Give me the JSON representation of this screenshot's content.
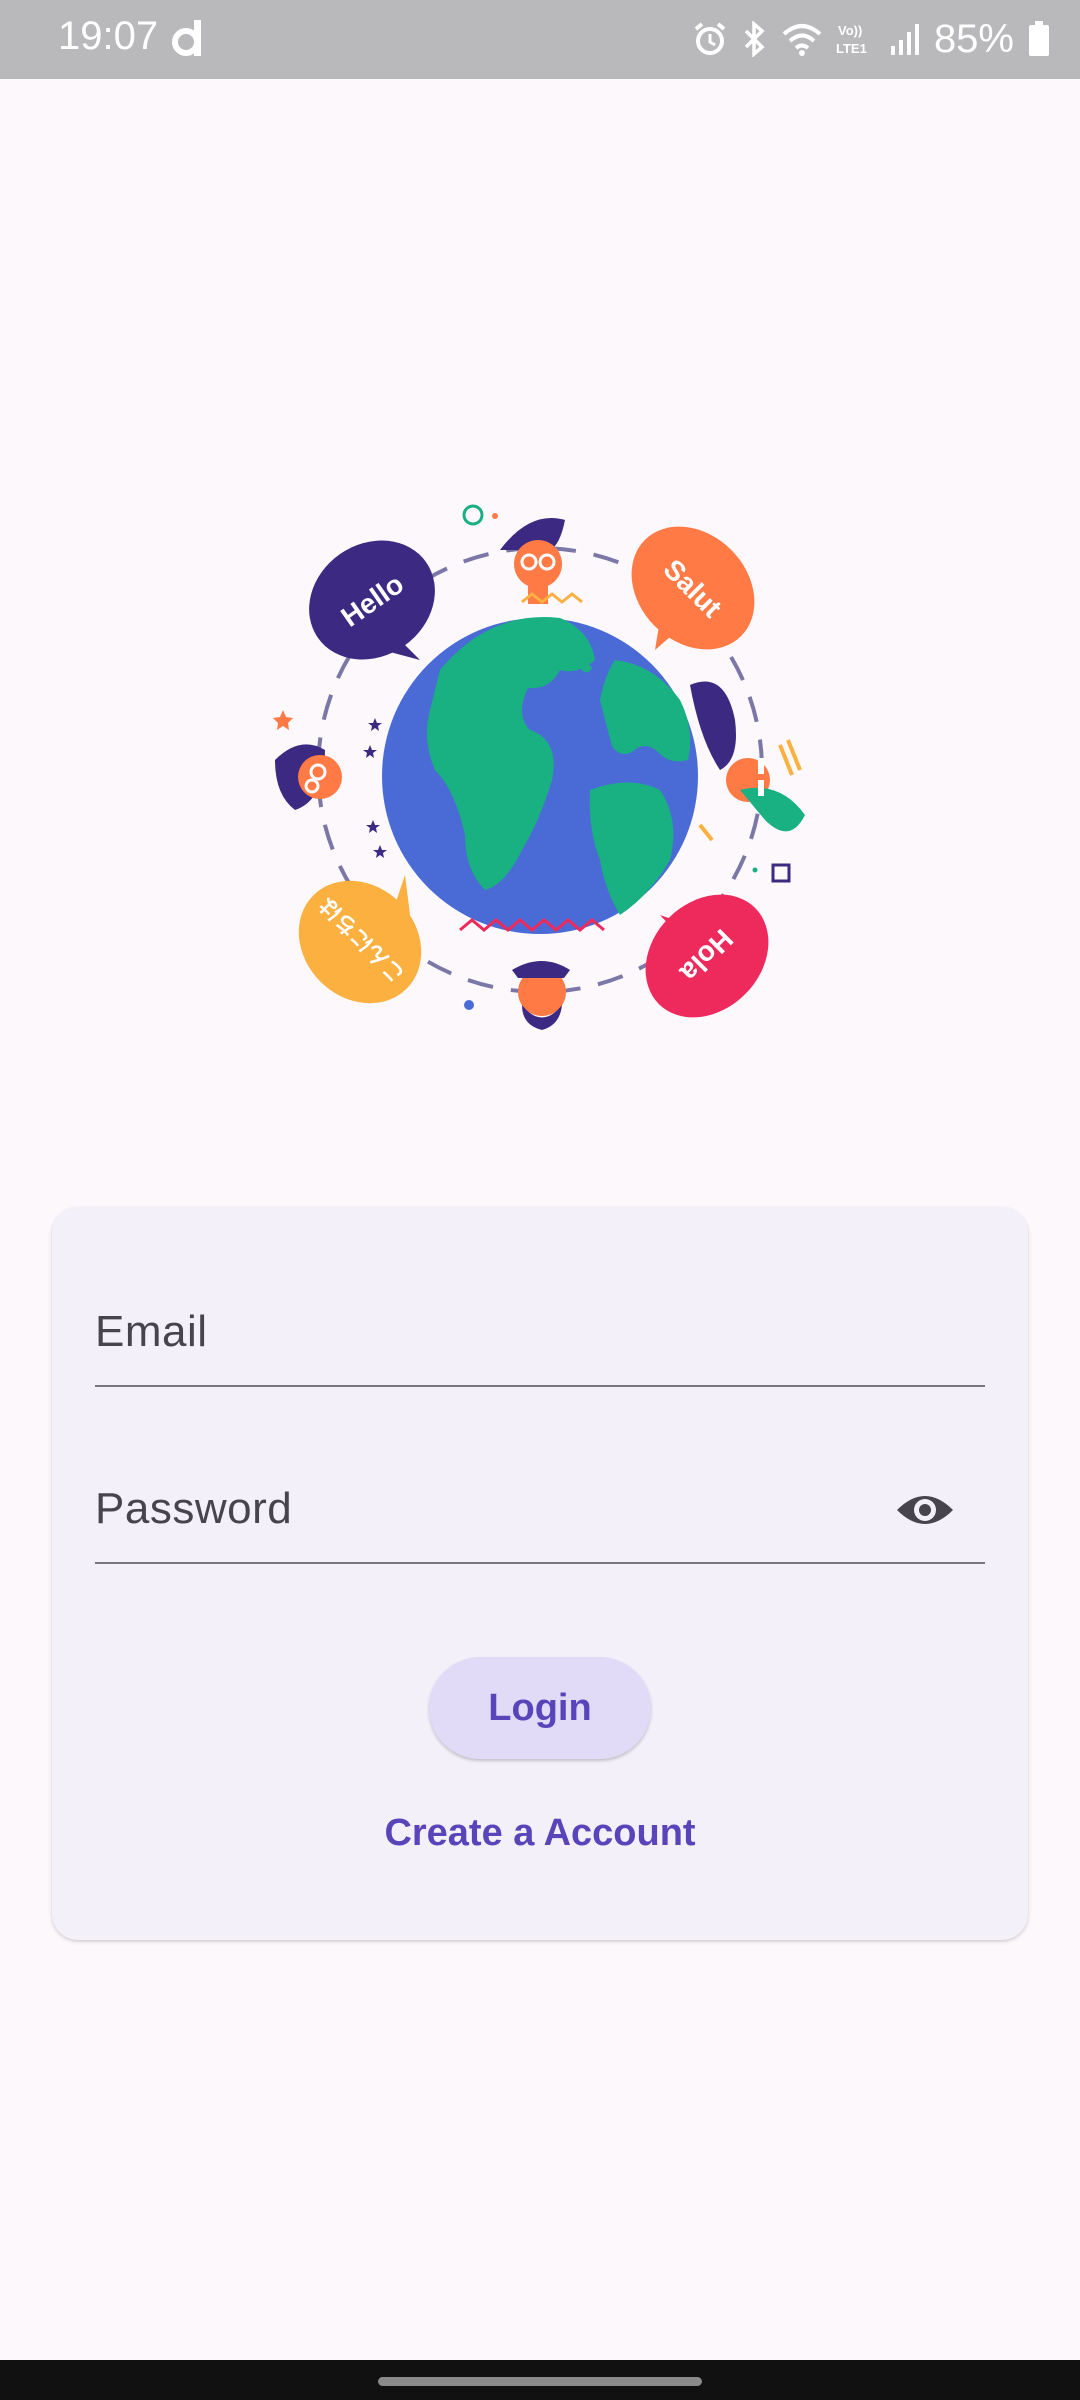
{
  "status_bar": {
    "time": "19:07",
    "battery_percent": "85%",
    "icons": [
      "app-notification-icon",
      "alarm-icon",
      "bluetooth-icon",
      "wifi-icon",
      "volte-icon",
      "signal-icon",
      "battery-icon"
    ],
    "volte_text": "VoLTE1"
  },
  "illustration": {
    "bubbles": [
      "Hello",
      "Salut",
      "Hola",
      "こんにちは"
    ],
    "colors": {
      "globe_ocean": "#4a6bd6",
      "land": "#19b082",
      "hello": "#3c2a82",
      "salut": "#ff7a45",
      "hola": "#ee2a5c",
      "konnichiwa": "#fbb040"
    }
  },
  "form": {
    "email_label": "Email",
    "email_value": "",
    "password_label": "Password",
    "password_value": "",
    "login_label": "Login",
    "create_account_label": "Create a Account"
  },
  "theme": {
    "accent": "#5a44b9",
    "card_bg": "#f4f0fa",
    "button_bg": "#e1dbf7"
  }
}
